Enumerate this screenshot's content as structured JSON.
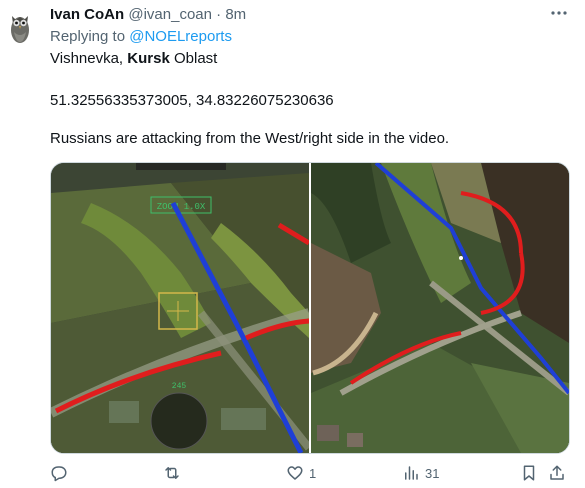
{
  "author": {
    "name": "Ivan CoAn",
    "handle": "@ivan_coan",
    "separator": "·",
    "time": "8m"
  },
  "reply": {
    "prefix": "Replying to",
    "target": "@NOELreports"
  },
  "body": {
    "location_part1": "Vishnevka,",
    "location_bold": "Kursk",
    "location_part2": "Oblast",
    "coordinates": "51.32556335373005, 34.83226075230636",
    "description": "Russians are attacking from the West/right side in the video."
  },
  "media": {
    "hud_zoom": "ZOOM  1.0X",
    "hud_heading": "245",
    "colors": {
      "red_line": "#e01d1d",
      "blue_line": "#1f3fd6"
    }
  },
  "actions": {
    "reply_icon": "reply-icon",
    "retweet_icon": "retweet-icon",
    "like_count": "1",
    "views_count": "31"
  },
  "colors": {
    "link": "#1d9bf0",
    "muted": "#536471"
  }
}
